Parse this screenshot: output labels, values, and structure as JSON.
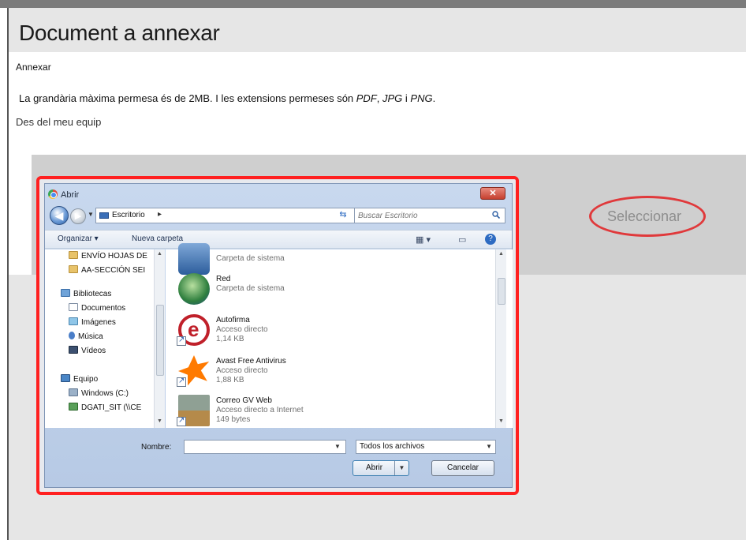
{
  "page": {
    "title": "Document a annexar",
    "subhead": "Annexar",
    "info_prefix": "La grandària màxima permesa és de 2MB. I les extensions permeses són ",
    "ext_pdf": "PDF",
    "ext_sep1": ", ",
    "ext_jpg": "JPG",
    "ext_sep2": " i ",
    "ext_png": "PNG",
    "ext_end": ".",
    "from_label": "Des del meu equip",
    "select_button": "Seleccionar",
    "accent_color": "#e0393b"
  },
  "dialog": {
    "title": "Abrir",
    "close_glyph": "✕",
    "address": "Escritorio",
    "address_sep": "▸",
    "search_placeholder": "Buscar Escritorio",
    "toolbar": {
      "organize": "Organizar ▾",
      "new_folder": "Nueva carpeta",
      "view_icon": "▦ ▾",
      "pane_icon": "▭",
      "help_icon": "?"
    },
    "nav_items": [
      {
        "label": "ENVÍO HOJAS DE",
        "icon": "folder-icon"
      },
      {
        "label": "AA-SECCIÓN SEI",
        "icon": "folder-icon"
      },
      {
        "label": "Bibliotecas",
        "icon": "library-icon"
      },
      {
        "label": "Documentos",
        "icon": "documents-icon"
      },
      {
        "label": "Imágenes",
        "icon": "images-icon"
      },
      {
        "label": "Música",
        "icon": "music-icon"
      },
      {
        "label": "Vídeos",
        "icon": "videos-icon"
      },
      {
        "label": "Equipo",
        "icon": "computer-icon"
      },
      {
        "label": "Windows (C:)",
        "icon": "drive-icon"
      },
      {
        "label": "DGATI_SIT (\\\\CE",
        "icon": "network-drive-icon"
      }
    ],
    "files": [
      {
        "name": "",
        "line1": "Carpeta de sistema",
        "line2": "",
        "icon": "computer-icon"
      },
      {
        "name": "Red",
        "line1": "Carpeta de sistema",
        "line2": "",
        "icon": "network-icon"
      },
      {
        "name": "Autofirma",
        "line1": "Acceso directo",
        "line2": "1,14 KB",
        "icon": "autofirma-icon"
      },
      {
        "name": "Avast Free Antivirus",
        "line1": "Acceso directo",
        "line2": "1,88 KB",
        "icon": "avast-icon"
      },
      {
        "name": "Correo GV Web",
        "line1": "Acceso directo a Internet",
        "line2": "149 bytes",
        "icon": "correo-gv-icon"
      }
    ],
    "name_label": "Nombre:",
    "name_value": "",
    "type_value": "Todos los archivos",
    "open_button": "Abrir",
    "cancel_button": "Cancelar"
  }
}
